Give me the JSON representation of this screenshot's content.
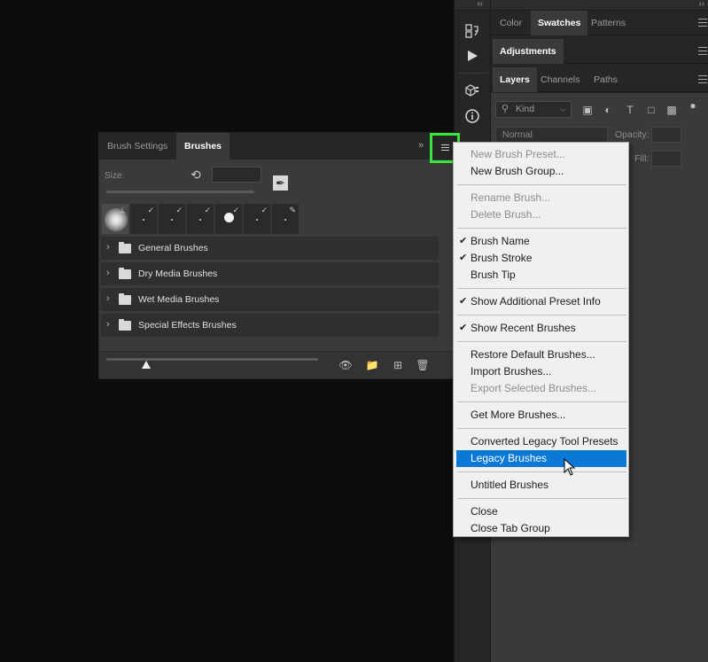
{
  "dock": {
    "collapse_glyph": "‹‹",
    "expand_glyph": "››",
    "tools": [
      "history-icon",
      "play-icon",
      "3d-cube-icon",
      "info-icon"
    ],
    "color_group": {
      "tabs": [
        "Color",
        "Swatches",
        "Patterns"
      ],
      "active": "Swatches"
    },
    "adjustments_group": {
      "tabs": [
        "Adjustments"
      ],
      "active": "Adjustments"
    },
    "layers_group": {
      "tabs": [
        "Layers",
        "Channels",
        "Paths"
      ],
      "active": "Layers"
    },
    "layers": {
      "kind_label": "Kind",
      "blend_mode": "Normal",
      "opacity_label": "Opacity:",
      "fill_label": "Fill:"
    }
  },
  "brushes_panel": {
    "tabs": [
      "Brush Settings",
      "Brushes"
    ],
    "active_tab": "Brushes",
    "size_label": "Size:",
    "recent_brushes": [
      "soft-round",
      "tip-1",
      "tip-2",
      "tip-3",
      "hard-round",
      "tip-4",
      "tip-5"
    ],
    "groups": [
      "General Brushes",
      "Dry Media Brushes",
      "Wet Media Brushes",
      "Special Effects Brushes"
    ],
    "preview_slider": 0.19
  },
  "flyout_menu": {
    "highlight_color": "#0a78d7",
    "highlighted_item": "Legacy Brushes",
    "sections": [
      [
        {
          "label": "New Brush Preset...",
          "enabled": false
        },
        {
          "label": "New Brush Group...",
          "enabled": true
        }
      ],
      [
        {
          "label": "Rename Brush...",
          "enabled": false
        },
        {
          "label": "Delete Brush...",
          "enabled": false
        }
      ],
      [
        {
          "label": "Brush Name",
          "enabled": true,
          "checked": true
        },
        {
          "label": "Brush Stroke",
          "enabled": true,
          "checked": true
        },
        {
          "label": "Brush Tip",
          "enabled": true,
          "checked": false
        }
      ],
      [
        {
          "label": "Show Additional Preset Info",
          "enabled": true,
          "checked": true
        }
      ],
      [
        {
          "label": "Show Recent Brushes",
          "enabled": true,
          "checked": true
        }
      ],
      [
        {
          "label": "Restore Default Brushes...",
          "enabled": true
        },
        {
          "label": "Import Brushes...",
          "enabled": true
        },
        {
          "label": "Export Selected Brushes...",
          "enabled": false
        }
      ],
      [
        {
          "label": "Get More Brushes...",
          "enabled": true
        }
      ],
      [
        {
          "label": "Converted Legacy Tool Presets",
          "enabled": true
        },
        {
          "label": "Legacy Brushes",
          "enabled": true
        }
      ],
      [
        {
          "label": "Untitled Brushes",
          "enabled": true
        }
      ],
      [
        {
          "label": "Close",
          "enabled": true
        },
        {
          "label": "Close Tab Group",
          "enabled": true
        }
      ]
    ]
  },
  "highlight_box_color": "#39e53a"
}
